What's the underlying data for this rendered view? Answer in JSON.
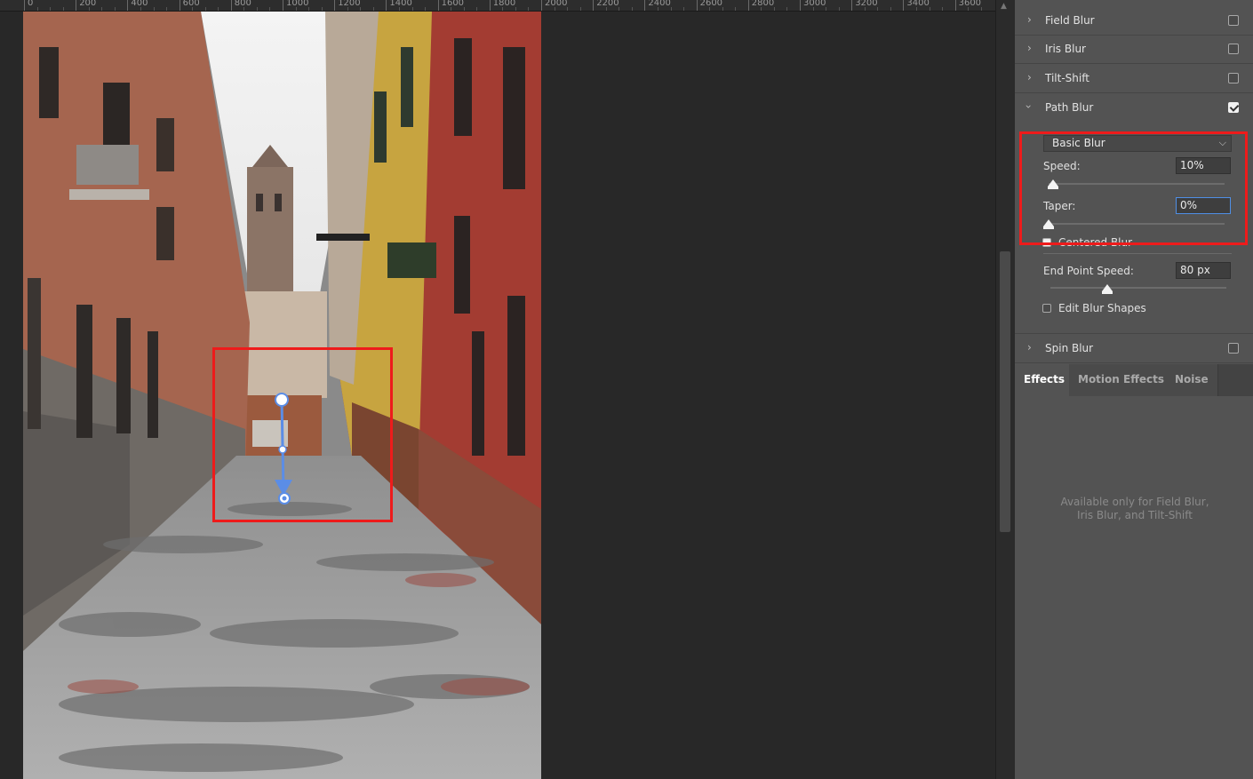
{
  "ruler": {
    "labels": [
      "0",
      "200",
      "400",
      "600",
      "800",
      "1000",
      "1200",
      "1400",
      "1600",
      "1800",
      "2000",
      "2200",
      "2400",
      "2600",
      "2800",
      "3000",
      "3200",
      "3400",
      "3600"
    ]
  },
  "panel": {
    "blur_rows": [
      {
        "label": "Field Blur",
        "checked": false
      },
      {
        "label": "Iris Blur",
        "checked": false
      },
      {
        "label": "Tilt-Shift",
        "checked": false
      },
      {
        "label": "Path Blur",
        "checked": true
      },
      {
        "label": "Spin Blur",
        "checked": false
      }
    ],
    "path_blur": {
      "mode": "Basic Blur",
      "speed_label": "Speed:",
      "speed_value": "10%",
      "speed_level": 0.1,
      "taper_label": "Taper:",
      "taper_value": "0%",
      "taper_level": 0.0,
      "centered_blur_label": "Centered Blur",
      "centered_blur_checked": true,
      "end_point_speed_label": "End Point Speed:",
      "end_point_speed_value": "80 px",
      "end_point_speed_level": 0.33,
      "edit_blur_shapes_label": "Edit Blur Shapes",
      "edit_blur_shapes_checked": false
    },
    "tabs": [
      "Effects",
      "Motion Effects",
      "Noise"
    ],
    "active_tab": "Effects",
    "note_line1": "Available only for Field Blur,",
    "note_line2": "Iris Blur, and Tilt-Shift"
  },
  "colors": {
    "highlight": "#ee1b1b",
    "path_blue": "#5b8de6",
    "panel_bg": "#535353"
  }
}
